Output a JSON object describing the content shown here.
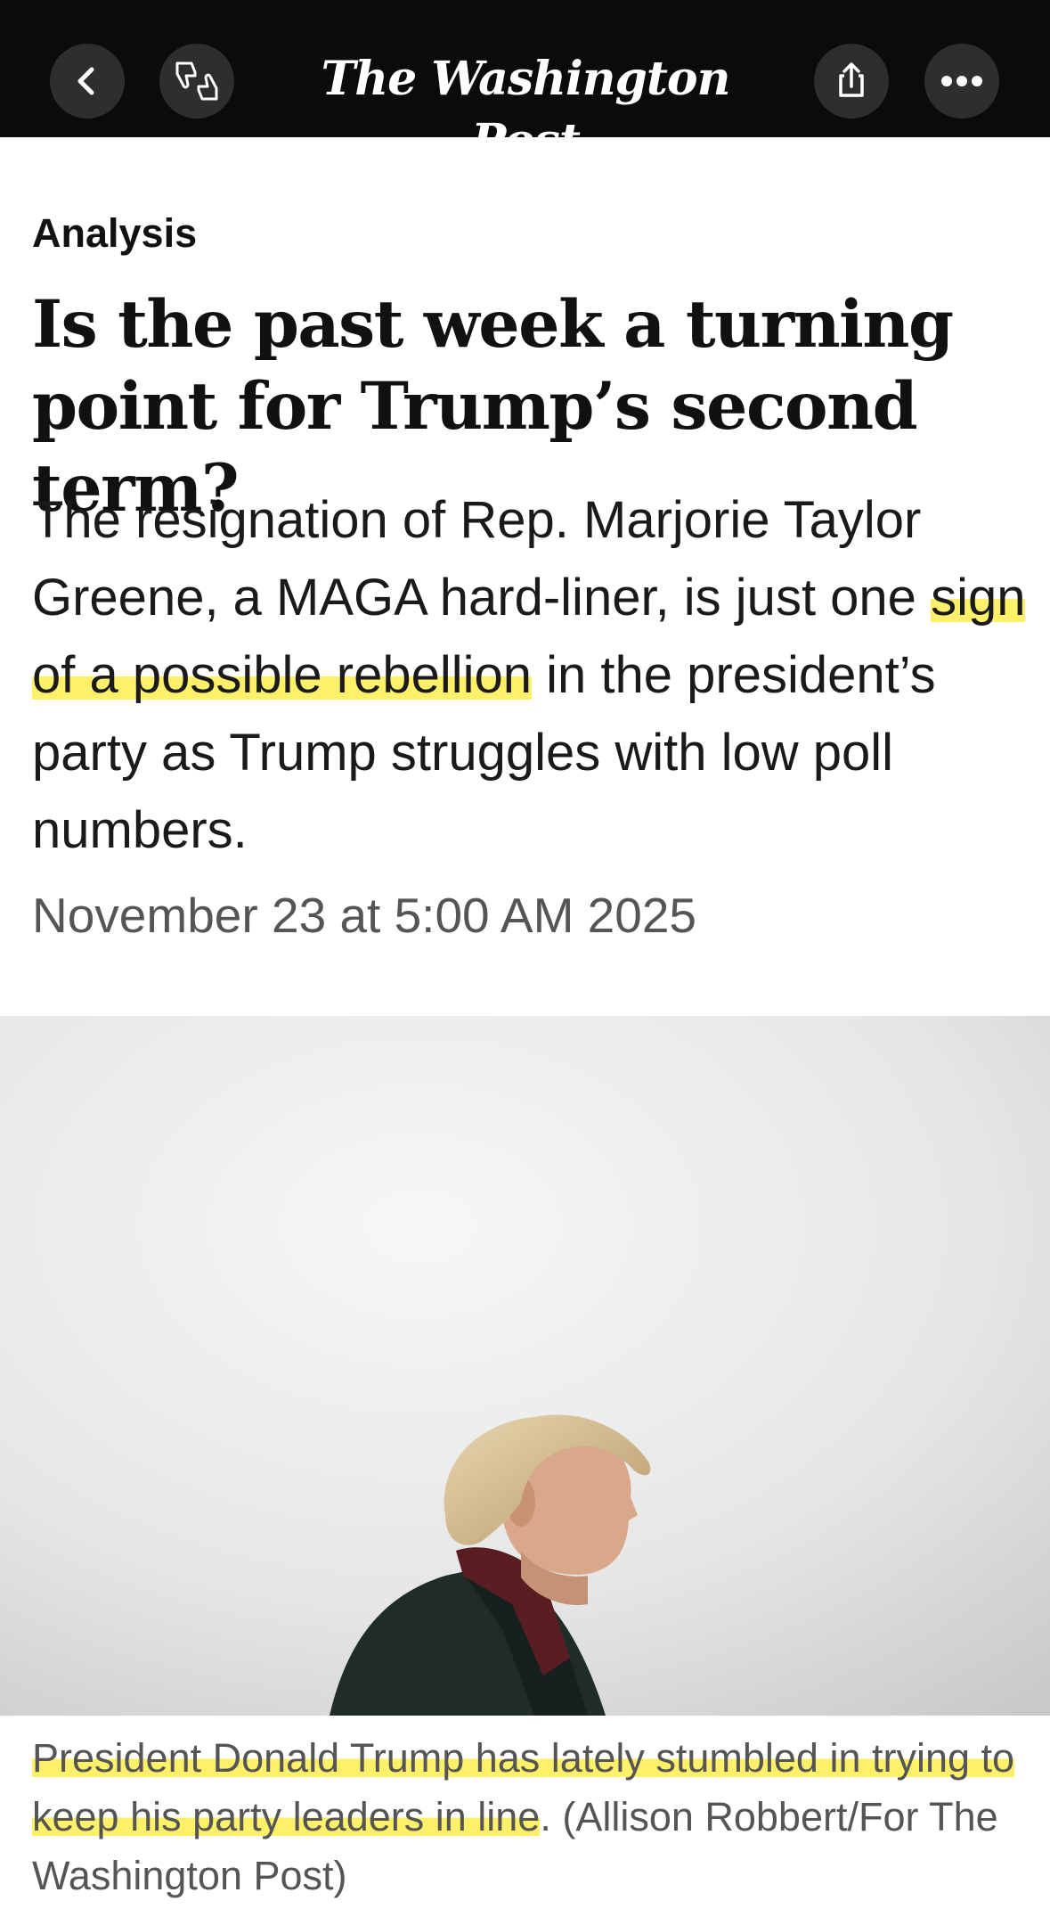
{
  "header": {
    "back_icon": "chevron-left-icon",
    "reactions_icon": "thumbs-up-down-icon",
    "masthead": "The Washington Post",
    "share_icon": "share-icon",
    "more_icon": "more-horizontal-icon"
  },
  "article": {
    "kicker": "Analysis",
    "headline": "Is the past week a turning point for Trump’s second term?",
    "dek_before": "The resignation of Rep. Marjorie Taylor Greene, a MAGA hard-liner, is just one ",
    "dek_highlight": "sign of a possible rebellion",
    "dek_after": " in the president’s party as Trump struggles with low poll numbers.",
    "date": "November 23 at 5:00 AM 2025"
  },
  "photo": {
    "caption_highlight": "President Donald Trump has lately stumbled in trying to keep his party leaders in line",
    "caption_after": ". (Allison Robbert/For The Washington Post)"
  },
  "colors": {
    "topbar": "#0b0b0b",
    "highlight": "#ffee50"
  }
}
